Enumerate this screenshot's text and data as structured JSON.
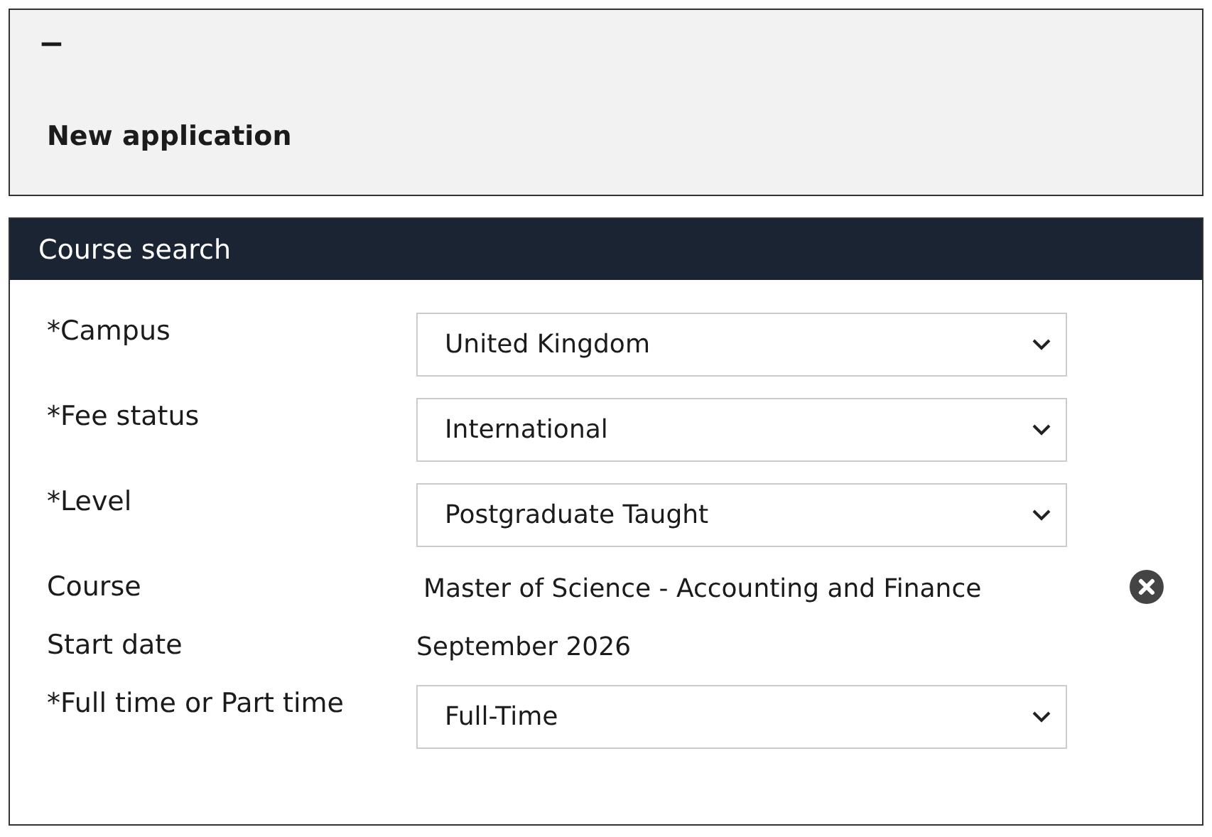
{
  "header": {
    "collapse_symbol": "−",
    "title": "New application"
  },
  "course_search": {
    "title": "Course search",
    "fields": [
      {
        "kind": "select",
        "label": "*Campus",
        "value": "United Kingdom"
      },
      {
        "kind": "select",
        "label": "*Fee status",
        "value": "International"
      },
      {
        "kind": "select",
        "label": "*Level",
        "value": "Postgraduate Taught"
      },
      {
        "kind": "clearable",
        "label": "Course",
        "value": "Master of Science - Accounting and Finance"
      },
      {
        "kind": "text",
        "label": "Start date",
        "value": "September 2026"
      },
      {
        "kind": "select",
        "label": "*Full time or Part time",
        "value": "Full-Time"
      }
    ]
  }
}
